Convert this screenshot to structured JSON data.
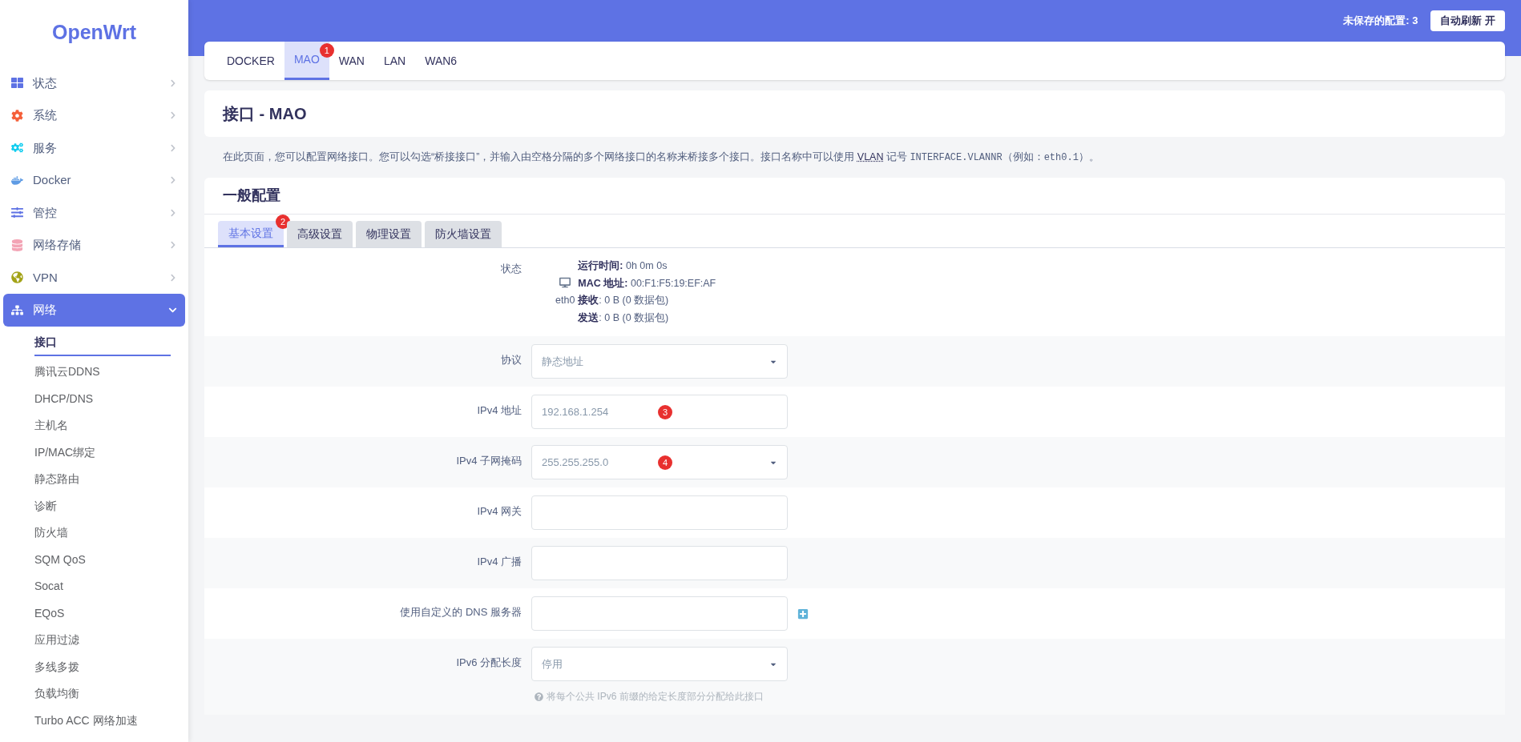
{
  "sidebar": {
    "logo": "OpenWrt",
    "items": [
      {
        "label": "状态",
        "expanded": false
      },
      {
        "label": "系统",
        "expanded": false
      },
      {
        "label": "服务",
        "expanded": false
      },
      {
        "label": "Docker",
        "expanded": false
      },
      {
        "label": "管控",
        "expanded": false
      },
      {
        "label": "网络存储",
        "expanded": false
      },
      {
        "label": "VPN",
        "expanded": false
      },
      {
        "label": "网络",
        "expanded": true,
        "children": [
          {
            "label": "接口",
            "selected": true
          },
          {
            "label": "腾讯云DDNS",
            "selected": false
          },
          {
            "label": "DHCP/DNS",
            "selected": false
          },
          {
            "label": "主机名",
            "selected": false
          },
          {
            "label": "IP/MAC绑定",
            "selected": false
          },
          {
            "label": "静态路由",
            "selected": false
          },
          {
            "label": "诊断",
            "selected": false
          },
          {
            "label": "防火墙",
            "selected": false
          },
          {
            "label": "SQM QoS",
            "selected": false
          },
          {
            "label": "Socat",
            "selected": false
          },
          {
            "label": "EQoS",
            "selected": false
          },
          {
            "label": "应用过滤",
            "selected": false
          },
          {
            "label": "多线多拨",
            "selected": false
          },
          {
            "label": "负载均衡",
            "selected": false
          },
          {
            "label": "Turbo ACC 网络加速",
            "selected": false
          }
        ]
      }
    ]
  },
  "header": {
    "unsaved": "未保存的配置: 3",
    "refresh_button": "自动刷新 开"
  },
  "interface_tabs": [
    {
      "label": "DOCKER",
      "selected": false
    },
    {
      "label": "MAO",
      "selected": true,
      "marker": "1"
    },
    {
      "label": "WAN",
      "selected": false
    },
    {
      "label": "LAN",
      "selected": false
    },
    {
      "label": "WAN6",
      "selected": false
    }
  ],
  "page_title": "接口 - MAO",
  "description": [
    {
      "kind": "text",
      "text": "在此页面，您可以配置网络接口。您可以勾选“桥接接口”，并输入由空格分隔的多个网络接口的名称来桥接多个接口。接口名称中可以使用 "
    },
    {
      "kind": "link",
      "text": "VLAN"
    },
    {
      "kind": "text",
      "text": " 记号 "
    },
    {
      "kind": "code",
      "text": "INTERFACE.VLANNR"
    },
    {
      "kind": "text",
      "text": "（例如："
    },
    {
      "kind": "code",
      "text": "eth0.1"
    },
    {
      "kind": "text",
      "text": "）。"
    }
  ],
  "section": {
    "title": "一般配置",
    "tabs": [
      {
        "label": "基本设置",
        "selected": true,
        "marker": "2"
      },
      {
        "label": "高级设置",
        "selected": false
      },
      {
        "label": "物理设置",
        "selected": false
      },
      {
        "label": "防火墙设置",
        "selected": false
      }
    ],
    "status": {
      "label": "状态",
      "device": "eth0",
      "lines": [
        {
          "key": "运行时间:",
          "value": " 0h 0m 0s"
        },
        {
          "key": "MAC 地址:",
          "value": " 00:F1:F5:19:EF:AF"
        },
        {
          "key": "接收",
          "value": ": 0 B (0 数据包)"
        },
        {
          "key": "发送",
          "value": ": 0 B (0 数据包)"
        }
      ]
    },
    "fields": [
      {
        "label": "协议",
        "kind": "select",
        "value": "静态地址"
      },
      {
        "label": "IPv4 地址",
        "kind": "input",
        "value": "192.168.1.254",
        "marker": "3"
      },
      {
        "label": "IPv4 子网掩码",
        "kind": "select",
        "value": "255.255.255.0",
        "marker": "4"
      },
      {
        "label": "IPv4 网关",
        "kind": "input"
      },
      {
        "label": "IPv4 广播",
        "kind": "input"
      },
      {
        "label": "使用自定义的 DNS 服务器",
        "kind": "input",
        "add_button": true
      },
      {
        "label": "IPv6 分配长度",
        "kind": "select",
        "value": "停用",
        "help": "将每个公共 IPv6 前缀的给定长度部分分配给此接口"
      }
    ]
  }
}
